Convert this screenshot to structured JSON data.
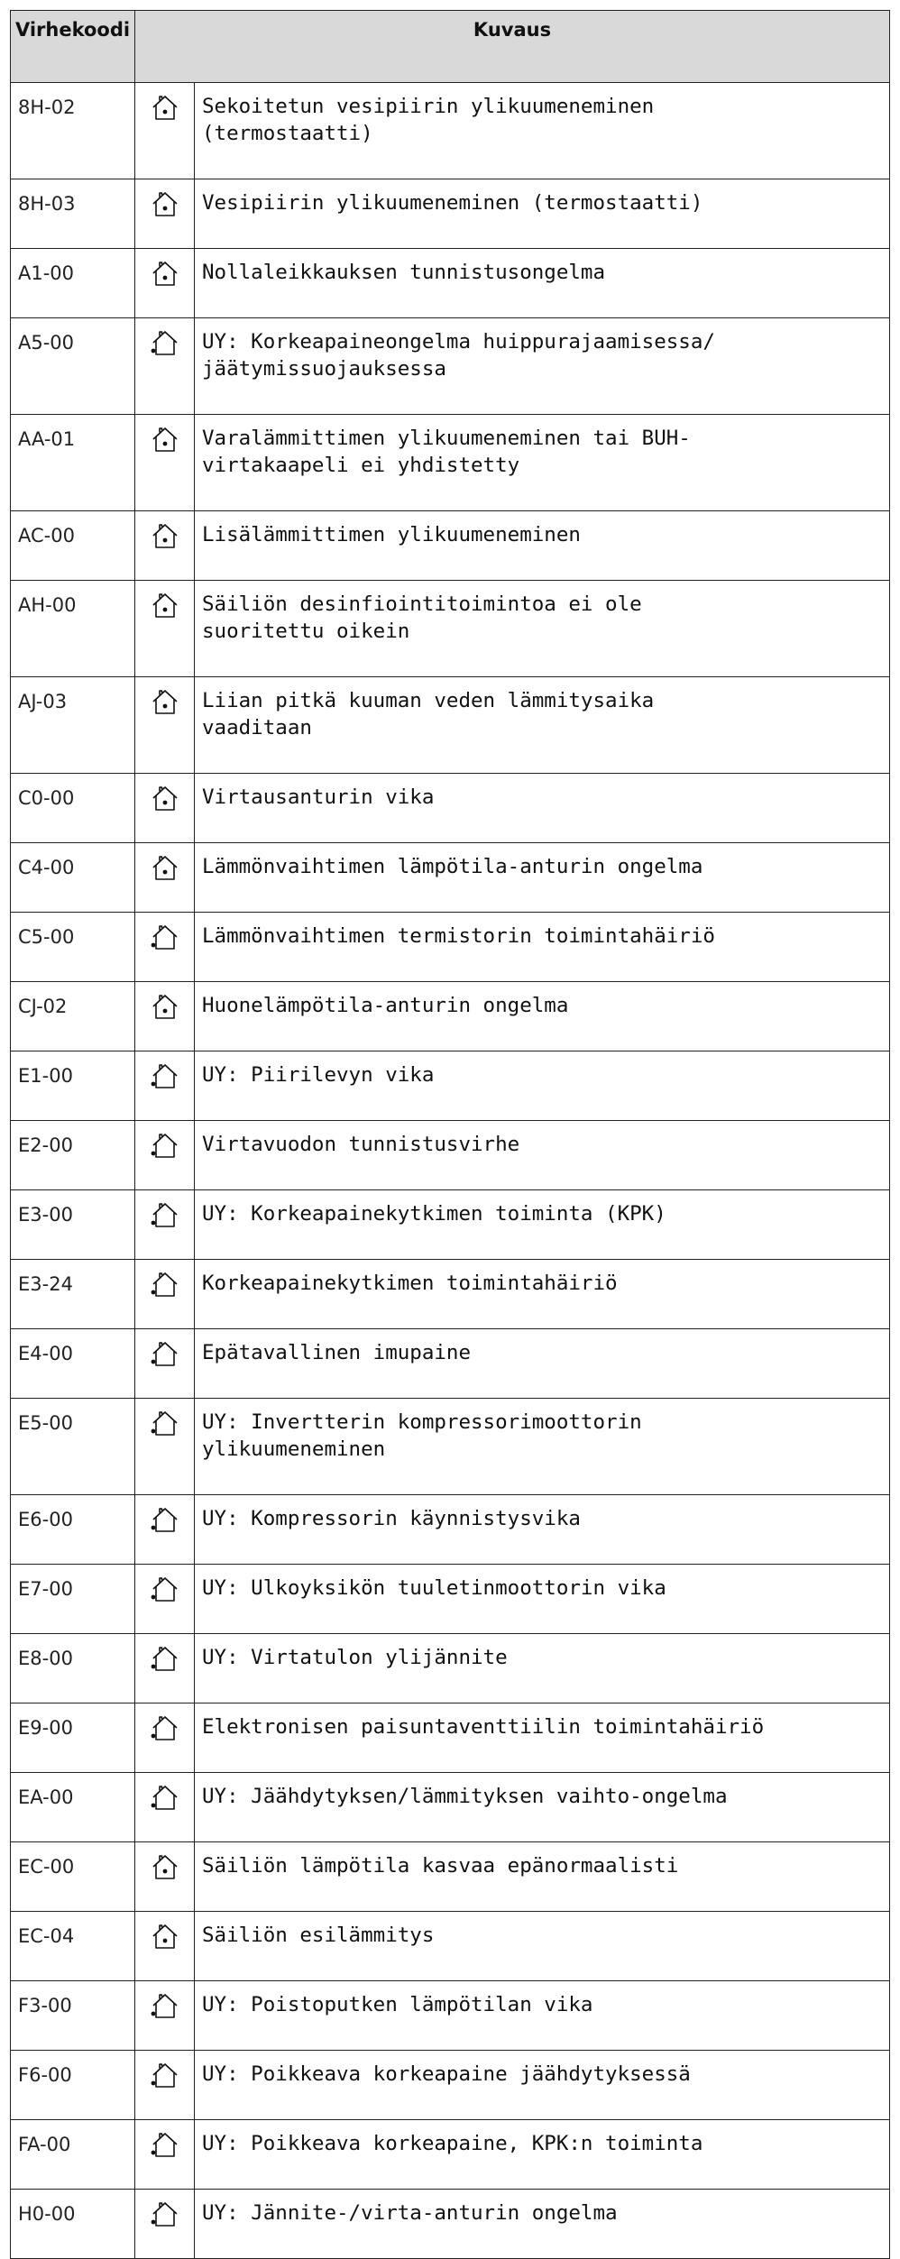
{
  "table": {
    "headers": {
      "code": "Virhekoodi",
      "description": "Kuvaus"
    },
    "rows": [
      {
        "code": "8H-02",
        "icon": "house-user-icon",
        "lines": [
          "Sekoitetun vesipiirin ylikuumeneminen",
          "(termostaatti)"
        ]
      },
      {
        "code": "8H-03",
        "icon": "house-user-icon",
        "lines": [
          "Vesipiirin ylikuumeneminen (termostaatti)"
        ]
      },
      {
        "code": "A1-00",
        "icon": "house-user-icon",
        "lines": [
          "Nollaleikkauksen tunnistusongelma"
        ]
      },
      {
        "code": "A5-00",
        "icon": "house-installer-icon",
        "lines": [
          "UY: Korkeapaineongelma huippurajaamisessa/",
          "jäätymissuojauksessa"
        ]
      },
      {
        "code": "AA-01",
        "icon": "house-user-icon",
        "lines": [
          "Varalämmittimen ylikuumeneminen tai BUH-",
          "virtakaapeli ei yhdistetty"
        ]
      },
      {
        "code": "AC-00",
        "icon": "house-user-icon",
        "lines": [
          "Lisälämmittimen ylikuumeneminen"
        ]
      },
      {
        "code": "AH-00",
        "icon": "house-user-icon",
        "lines": [
          "Säiliön desinfiointitoimintoa ei ole",
          "suoritettu oikein"
        ]
      },
      {
        "code": "AJ-03",
        "icon": "house-user-icon",
        "lines": [
          "Liian pitkä kuuman veden lämmitysaika",
          "vaaditaan"
        ]
      },
      {
        "code": "C0-00",
        "icon": "house-user-icon",
        "lines": [
          "Virtausanturin vika"
        ]
      },
      {
        "code": "C4-00",
        "icon": "house-user-icon",
        "lines": [
          "Lämmönvaihtimen lämpötila-anturin ongelma"
        ]
      },
      {
        "code": "C5-00",
        "icon": "house-installer-icon",
        "lines": [
          "Lämmönvaihtimen termistorin toimintahäiriö"
        ]
      },
      {
        "code": "CJ-02",
        "icon": "house-user-icon",
        "lines": [
          "Huonelämpötila-anturin ongelma"
        ]
      },
      {
        "code": "E1-00",
        "icon": "house-installer-icon",
        "lines": [
          "UY: Piirilevyn vika"
        ]
      },
      {
        "code": "E2-00",
        "icon": "house-installer-icon",
        "lines": [
          "Virtavuodon tunnistusvirhe"
        ]
      },
      {
        "code": "E3-00",
        "icon": "house-installer-icon",
        "lines": [
          "UY: Korkeapainekytkimen toiminta (KPK)"
        ]
      },
      {
        "code": "E3-24",
        "icon": "house-installer-icon",
        "lines": [
          "Korkeapainekytkimen toimintahäiriö"
        ]
      },
      {
        "code": "E4-00",
        "icon": "house-installer-icon",
        "lines": [
          "Epätavallinen imupaine"
        ]
      },
      {
        "code": "E5-00",
        "icon": "house-installer-icon",
        "lines": [
          "UY: Invertterin kompressorimoottorin",
          "ylikuumeneminen"
        ]
      },
      {
        "code": "E6-00",
        "icon": "house-installer-icon",
        "lines": [
          "UY: Kompressorin käynnistysvika"
        ]
      },
      {
        "code": "E7-00",
        "icon": "house-installer-icon",
        "lines": [
          "UY: Ulkoyksikön tuuletinmoottorin vika"
        ]
      },
      {
        "code": "E8-00",
        "icon": "house-installer-icon",
        "lines": [
          "UY: Virtatulon ylijännite"
        ]
      },
      {
        "code": "E9-00",
        "icon": "house-installer-icon",
        "lines": [
          "Elektronisen paisuntaventtiilin toimintahäiriö"
        ]
      },
      {
        "code": "EA-00",
        "icon": "house-installer-icon",
        "lines": [
          "UY: Jäähdytyksen/lämmityksen vaihto-ongelma"
        ]
      },
      {
        "code": "EC-00",
        "icon": "house-user-icon",
        "lines": [
          "Säiliön lämpötila kasvaa epänormaalisti"
        ]
      },
      {
        "code": "EC-04",
        "icon": "house-user-icon",
        "lines": [
          "Säiliön esilämmitys"
        ]
      },
      {
        "code": "F3-00",
        "icon": "house-installer-icon",
        "lines": [
          "UY: Poistoputken lämpötilan vika"
        ]
      },
      {
        "code": "F6-00",
        "icon": "house-installer-icon",
        "lines": [
          "UY: Poikkeava korkeapaine jäähdytyksessä"
        ]
      },
      {
        "code": "FA-00",
        "icon": "house-installer-icon",
        "lines": [
          "UY: Poikkeava korkeapaine, KPK:n toiminta"
        ]
      },
      {
        "code": "H0-00",
        "icon": "house-installer-icon",
        "lines": [
          "UY: Jännite-/virta-anturin ongelma"
        ]
      }
    ]
  }
}
